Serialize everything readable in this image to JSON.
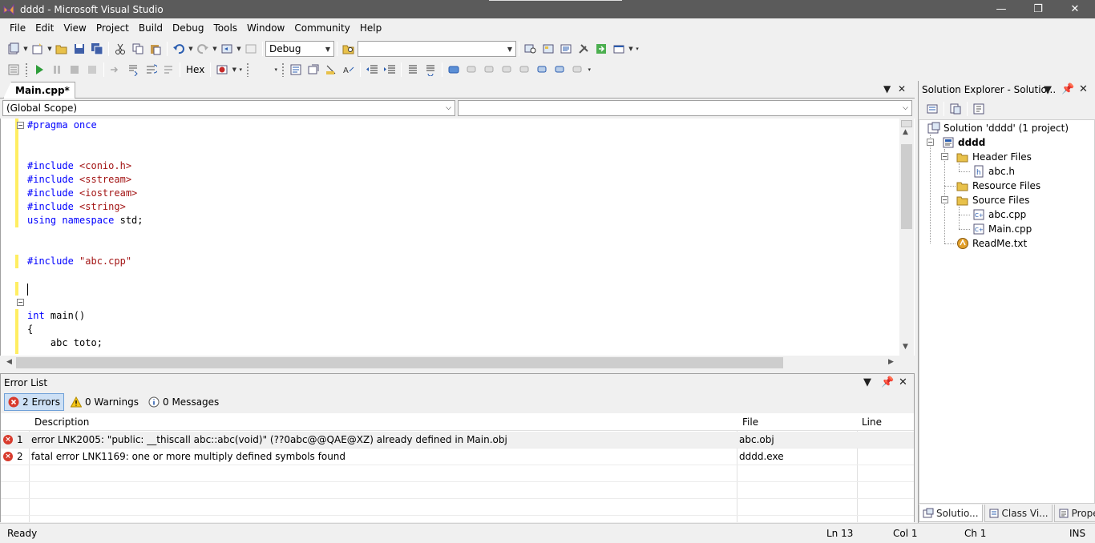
{
  "window": {
    "title": "dddd - Microsoft Visual Studio",
    "minimize": "—",
    "restore": "❐",
    "close": "✕"
  },
  "menu": [
    "File",
    "Edit",
    "View",
    "Project",
    "Build",
    "Debug",
    "Tools",
    "Window",
    "Community",
    "Help"
  ],
  "toolbar": {
    "config_value": "Debug",
    "find_value": "",
    "hex_label": "Hex"
  },
  "document": {
    "tab_label": "Main.cpp*",
    "scope_left": "(Global Scope)",
    "scope_right": "",
    "code_lines": [
      {
        "parts": [
          {
            "t": "#pragma once",
            "c": "kw"
          }
        ]
      },
      {
        "parts": []
      },
      {
        "parts": []
      },
      {
        "parts": [
          {
            "t": "#include ",
            "c": "kw"
          },
          {
            "t": "<conio.h>",
            "c": "str"
          }
        ]
      },
      {
        "parts": [
          {
            "t": "#include ",
            "c": "kw"
          },
          {
            "t": "<sstream>",
            "c": "str"
          }
        ]
      },
      {
        "parts": [
          {
            "t": "#include ",
            "c": "kw"
          },
          {
            "t": "<iostream>",
            "c": "str"
          }
        ]
      },
      {
        "parts": [
          {
            "t": "#include ",
            "c": "kw"
          },
          {
            "t": "<string>",
            "c": "str"
          }
        ]
      },
      {
        "parts": [
          {
            "t": "using ",
            "c": "kw"
          },
          {
            "t": "namespace ",
            "c": "kw"
          },
          {
            "t": "std;",
            "c": ""
          }
        ]
      },
      {
        "parts": []
      },
      {
        "parts": []
      },
      {
        "parts": [
          {
            "t": "#include ",
            "c": "kw"
          },
          {
            "t": "\"abc.cpp\"",
            "c": "str"
          }
        ]
      },
      {
        "parts": []
      },
      {
        "parts": []
      },
      {
        "parts": []
      },
      {
        "parts": [
          {
            "t": "int ",
            "c": "kw"
          },
          {
            "t": "main()",
            "c": ""
          }
        ]
      },
      {
        "parts": [
          {
            "t": "{",
            "c": ""
          }
        ]
      },
      {
        "parts": [
          {
            "t": "    abc toto;",
            "c": ""
          }
        ]
      }
    ]
  },
  "error_list": {
    "title": "Error List",
    "filters": {
      "errors": "2 Errors",
      "warnings": "0 Warnings",
      "messages": "0 Messages"
    },
    "columns": {
      "description": "Description",
      "file": "File",
      "line": "Line"
    },
    "rows": [
      {
        "num": "1",
        "description": "error LNK2005: \"public: __thiscall abc::abc(void)\" (??0abc@@QAE@XZ) already defined in Main.obj",
        "file": "abc.obj",
        "line": ""
      },
      {
        "num": "2",
        "description": "fatal error LNK1169: one or more multiply defined symbols found",
        "file": "dddd.exe",
        "line": ""
      }
    ]
  },
  "solution_explorer": {
    "title": "Solution Explorer - Solutio...",
    "solution": "Solution 'dddd' (1 project)",
    "project": "dddd",
    "header_files": "Header Files",
    "abc_h": "abc.h",
    "resource_files": "Resource Files",
    "source_files": "Source Files",
    "abc_cpp": "abc.cpp",
    "main_cpp": "Main.cpp",
    "readme": "ReadMe.txt",
    "tabs": [
      "Solutio...",
      "Class Vi...",
      "Propert..."
    ]
  },
  "status": {
    "state": "Ready",
    "ln": "Ln 13",
    "col": "Col 1",
    "ch": "Ch 1",
    "mode": "INS"
  },
  "colors": {
    "titlebar": "#5b5b5b",
    "keyword": "#0000ff",
    "string": "#a31515",
    "change_bar": "#ffee62",
    "error_icon": "#d83b2d"
  }
}
